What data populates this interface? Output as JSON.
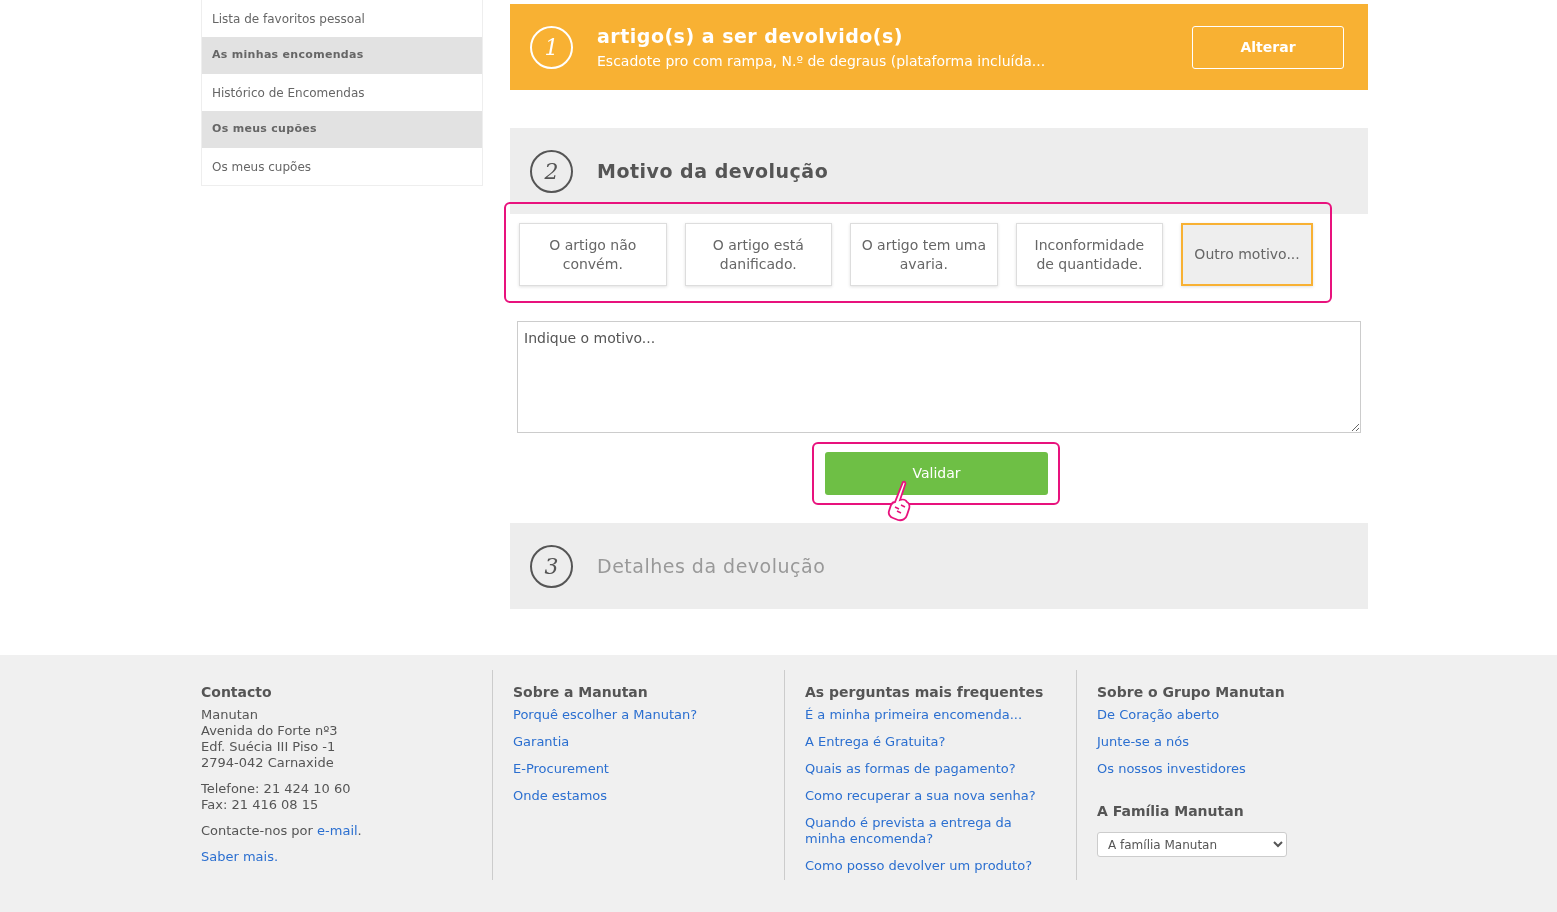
{
  "sidebar": {
    "items": [
      {
        "label": "Lista de favoritos pessoal",
        "kind": "link"
      },
      {
        "label": "As minhas encomendas",
        "kind": "heading"
      },
      {
        "label": "Histórico de Encomendas",
        "kind": "link"
      },
      {
        "label": "Os meus cupões",
        "kind": "heading"
      },
      {
        "label": "Os meus cupões",
        "kind": "link"
      }
    ]
  },
  "steps": [
    {
      "number": "1",
      "kind": "done",
      "title": "artigo(s) a ser devolvido(s)",
      "subtitle": "Escadote pro com rampa, N.º de degraus (plataforma incluída...",
      "button": "Alterar"
    },
    {
      "number": "2",
      "kind": "current",
      "title": "Motivo da devolução",
      "reasons": {
        "highlighted": true,
        "options": [
          {
            "label": "O artigo não convém.",
            "selected": false
          },
          {
            "label": "O artigo está danificado.",
            "selected": false
          },
          {
            "label": "O artigo tem uma avaria.",
            "selected": false
          },
          {
            "label": "Inconformidade de quantidade.",
            "selected": false
          },
          {
            "label": "Outro motivo...",
            "selected": true
          }
        ]
      },
      "reason_field": {
        "placeholder": "Indique o motivo..."
      },
      "submit": {
        "label": "Validar",
        "highlighted": true
      }
    },
    {
      "number": "3",
      "kind": "pending",
      "title": "Detalhes da devolução"
    }
  ],
  "footer": {
    "columns": [
      {
        "kind": "contact",
        "heading": "Contacto",
        "address": [
          "Manutan",
          "Avenida do Forte nº3",
          "Edf. Suécia III Piso -1",
          "2794-042 Carnaxide"
        ],
        "phones": [
          "Telefone: 21 424 10 60",
          "Fax: 21 416 08 15"
        ],
        "email": {
          "before": "Contacte-nos por ",
          "link": "e-mail",
          "after": "."
        },
        "more": "Saber mais."
      },
      {
        "kind": "links",
        "heading": "Sobre a Manutan",
        "links": [
          "Porquê escolher a Manutan?",
          "Garantia",
          "E-Procurement",
          "Onde estamos"
        ]
      },
      {
        "kind": "links",
        "heading": "As perguntas mais frequentes",
        "links": [
          "É a minha primeira encomenda...",
          "A Entrega é Gratuita?",
          "Quais as formas de pagamento?",
          "Como recuperar a sua nova senha?",
          "Quando é prevista a entrega da minha encomenda?",
          "Como posso devolver um produto?"
        ]
      },
      {
        "kind": "group",
        "heading": "Sobre o Grupo Manutan",
        "links": [
          "De Coração aberto",
          "Junte-se a nós",
          "Os nossos investidores"
        ],
        "subheading": "A Família Manutan",
        "select": "A família Manutan"
      }
    ]
  }
}
